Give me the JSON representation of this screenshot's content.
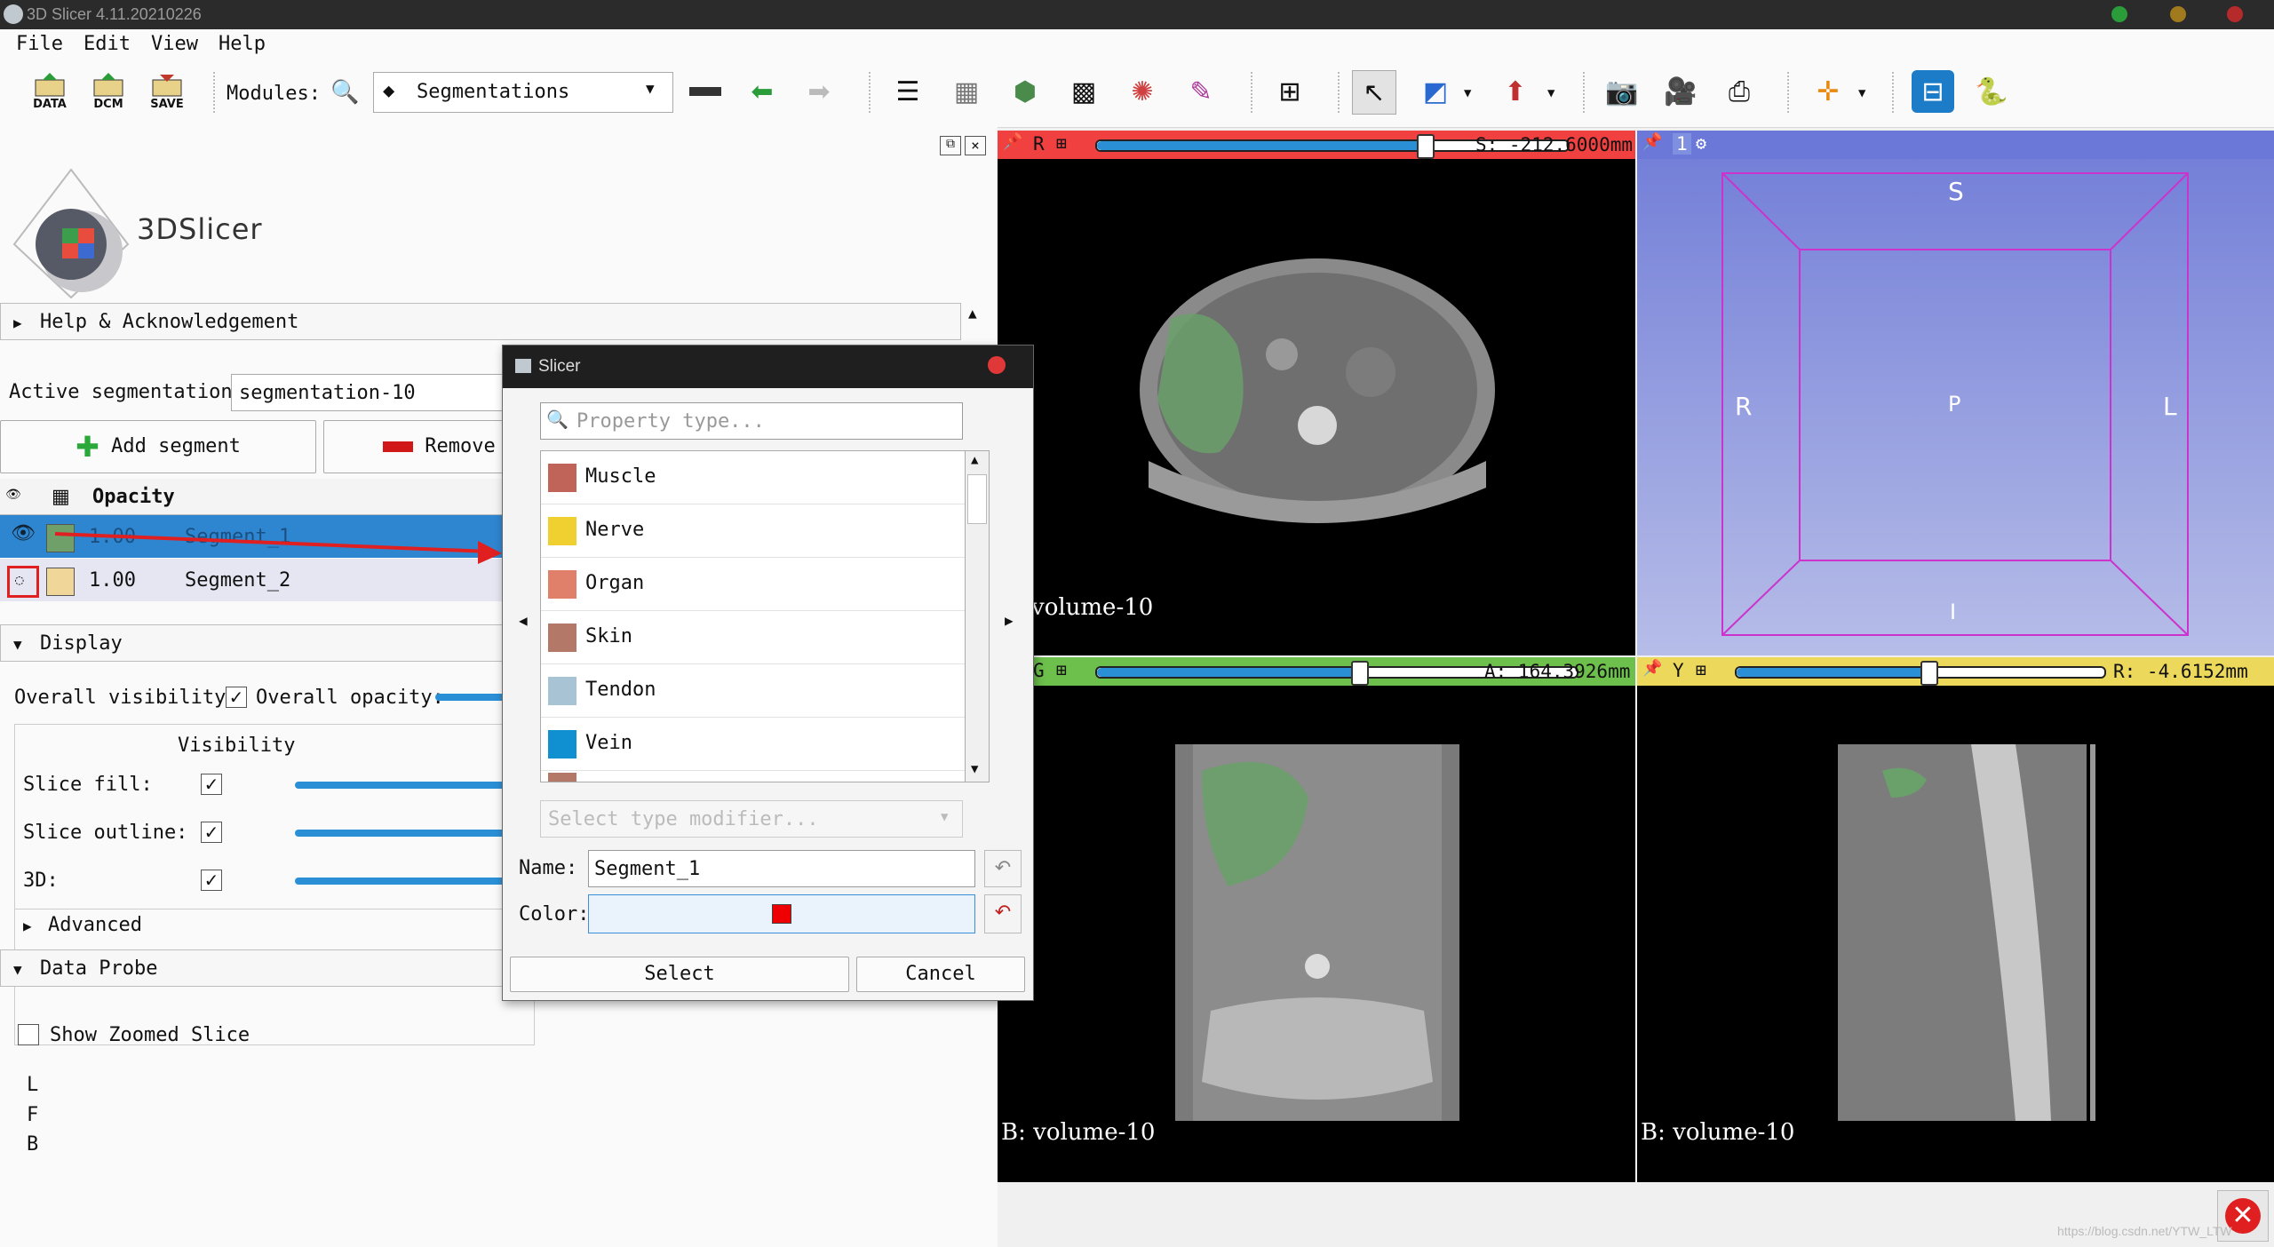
{
  "window": {
    "title": "3D Slicer 4.11.20210226"
  },
  "menu": [
    "File",
    "Edit",
    "View",
    "Help"
  ],
  "toolbar": {
    "data_label": "DATA",
    "dcm_label": "DCM",
    "save_label": "SAVE",
    "modules_label": "Modules:",
    "module_selected": "Segmentations"
  },
  "left": {
    "logo_text": "3DSlicer",
    "help_section": "Help & Acknowledgement",
    "active_seg_label": "Active segmentation:",
    "active_seg_value": "segmentation-10",
    "add_segment": "Add segment",
    "remove_segment": "Remove s",
    "table_header_opacity": "Opacity",
    "segments": [
      {
        "opacity": "1.00",
        "name": "Segment_1",
        "color": "#6fa06a"
      },
      {
        "opacity": "1.00",
        "name": "Segment_2",
        "color": "#f1d699"
      }
    ],
    "display_section": "Display",
    "overall_visibility": "Overall visibility:",
    "overall_opacity": "Overall opacity:",
    "visibility_header": "Visibility",
    "slice_fill": "Slice fill:",
    "slice_outline": "Slice outline:",
    "threed": "3D:",
    "advanced": "Advanced",
    "data_probe": "Data Probe",
    "show_zoomed": "Show Zoomed Slice",
    "probe_lines": [
      "L",
      "F",
      "B"
    ]
  },
  "views": {
    "red": {
      "letter": "R",
      "offset": "S: -212.6000mm",
      "label": "volume-10"
    },
    "threed": {
      "letter": "1",
      "labels": {
        "top": "S",
        "left": "R",
        "center": "P",
        "right": "L",
        "bottom": "I"
      }
    },
    "green": {
      "letter": "G",
      "offset": "A: 164.3926mm",
      "label": "B: volume-10"
    },
    "yellow": {
      "letter": "Y",
      "offset": "R: -4.6152mm",
      "label": "B: volume-10"
    }
  },
  "dialog": {
    "title": "Slicer",
    "search_placeholder": "Property type...",
    "items": [
      {
        "label": "Muscle",
        "color": "#c0645a"
      },
      {
        "label": "Nerve",
        "color": "#f0d030"
      },
      {
        "label": "Organ",
        "color": "#e0806a"
      },
      {
        "label": "Skin",
        "color": "#b47868"
      },
      {
        "label": "Tendon",
        "color": "#a8c4d4"
      },
      {
        "label": "Vein",
        "color": "#1090d0"
      }
    ],
    "modifier_placeholder": "Select type modifier...",
    "name_label": "Name:",
    "name_value": "Segment_1",
    "color_label": "Color:",
    "color_value": "#ee0000",
    "select": "Select",
    "cancel": "Cancel"
  },
  "watermark": "https://blog.csdn.net/YTW_LTW"
}
